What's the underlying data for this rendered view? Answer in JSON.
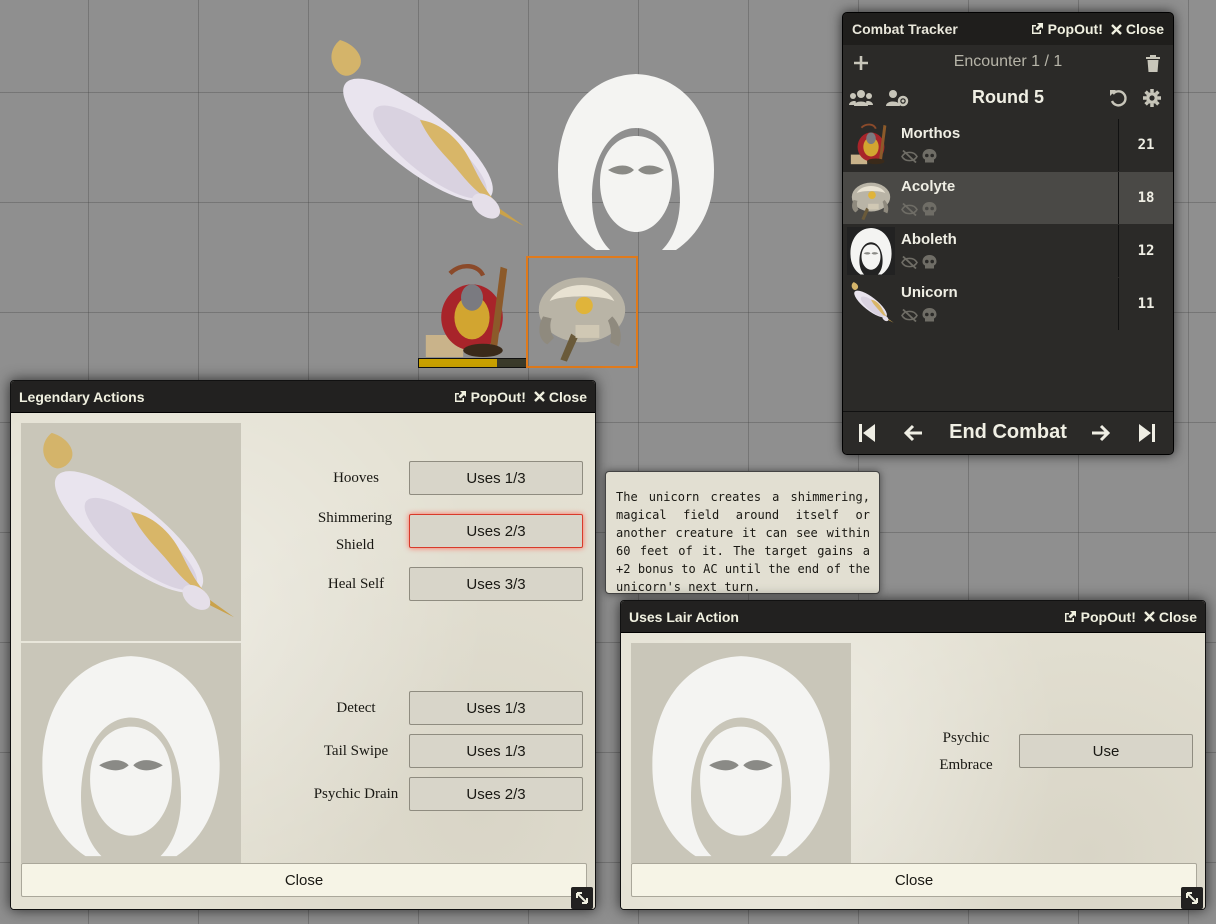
{
  "map": {
    "tokens": [
      "unicorn",
      "aboleth",
      "morthos",
      "acolyte"
    ],
    "selected_token": "acolyte",
    "selected_border_color": "#e07a1b",
    "morthos_hp_fraction": 0.72
  },
  "combat_tracker": {
    "title": "Combat Tracker",
    "popout_label": "PopOut!",
    "close_label": "Close",
    "encounter_label": "Encounter 1 / 1",
    "round_label": "Round 5",
    "end_combat_label": "End Combat",
    "active_combatant": "Acolyte",
    "combatants": [
      {
        "name": "Morthos",
        "initiative": "21",
        "portrait": "morthos"
      },
      {
        "name": "Acolyte",
        "initiative": "18",
        "portrait": "acolyte"
      },
      {
        "name": "Aboleth",
        "initiative": "12",
        "portrait": "hood"
      },
      {
        "name": "Unicorn",
        "initiative": "11",
        "portrait": "unicorn"
      }
    ]
  },
  "legendary_window": {
    "title": "Legendary Actions",
    "popout_label": "PopOut!",
    "close_label": "Close",
    "close_button_label": "Close",
    "groups": [
      {
        "portrait": "unicorn",
        "actions": [
          {
            "name": "Hooves",
            "uses": "Uses 1/3"
          },
          {
            "name": "Shimmering Shield",
            "uses": "Uses 2/3",
            "highlighted": true
          },
          {
            "name": "Heal Self",
            "uses": "Uses 3/3"
          }
        ]
      },
      {
        "portrait": "hood",
        "actions": [
          {
            "name": "Detect",
            "uses": "Uses 1/3"
          },
          {
            "name": "Tail Swipe",
            "uses": "Uses 1/3"
          },
          {
            "name": "Psychic Drain",
            "uses": "Uses 2/3"
          }
        ]
      }
    ]
  },
  "tooltip": {
    "text": "The unicorn creates a shimmering, magical field around itself or another creature it can see within 60 feet of it. The target gains a +2 bonus to AC until the end of the unicorn's next turn."
  },
  "lair_window": {
    "title": "Uses Lair Action",
    "popout_label": "PopOut!",
    "close_label": "Close",
    "close_button_label": "Close",
    "action_name": "Psychic Embrace",
    "action_button_label": "Use"
  },
  "icons": {
    "popout": "external-link-icon",
    "close": "x-icon",
    "add": "plus-icon",
    "delete": "trash-icon",
    "group": "users-icon",
    "reroll": "users-cog-icon",
    "reset": "undo-icon",
    "settings": "gear-icon",
    "hidden": "eye-slash-icon",
    "defeated": "skull-icon",
    "first_turn": "step-backward-icon",
    "prev_turn": "arrow-left-icon",
    "next_turn": "arrow-right-icon",
    "last_turn": "step-forward-icon",
    "resize": "resize-icon"
  },
  "colors": {
    "header_bg": "#222120",
    "window_bg": "#e4e1d3",
    "highlight": "#d83a2a",
    "tracker_bg": "#2b2a28",
    "active_row": "#4a4946"
  }
}
